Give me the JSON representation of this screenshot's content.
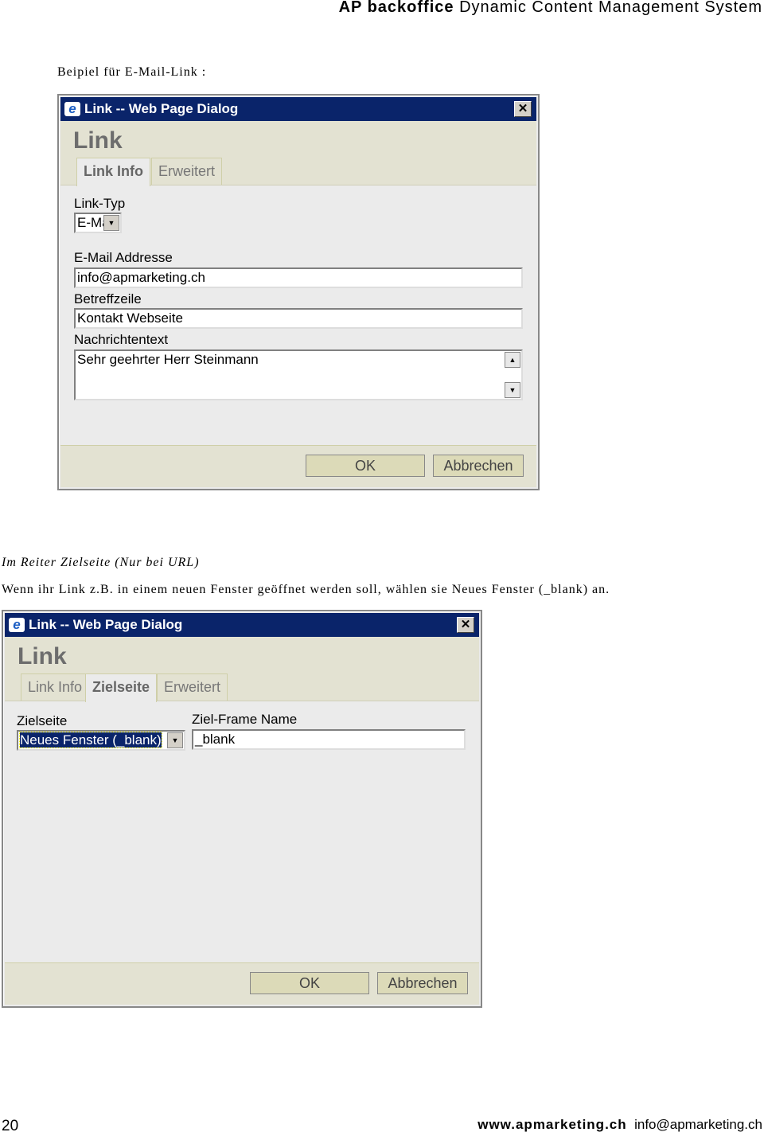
{
  "header": {
    "brand": "AP backoffice",
    "subtitle": "Dynamic Content Management System"
  },
  "intro": "Beipiel für E-Mail-Link :",
  "dialog1": {
    "title": "Link -- Web Page Dialog",
    "heading": "Link",
    "tabs": [
      "Link Info",
      "Erweitert"
    ],
    "active_tab": "Link Info",
    "link_type_label": "Link-Typ",
    "link_type_value": "E-Mail",
    "email_label": "E-Mail Addresse",
    "email_value": "info@apmarketing.ch",
    "subject_label": "Betreffzeile",
    "subject_value": "Kontakt Webseite",
    "body_label": "Nachrichtentext",
    "body_value": "Sehr geehrter Herr Steinmann",
    "ok": "OK",
    "cancel": "Abbrechen"
  },
  "section_title": "Im Reiter Zielseite (Nur bei URL)",
  "section_text": "Wenn ihr Link z.B. in einem neuen Fenster geöffnet werden soll, wählen sie Neues Fenster (_blank) an.",
  "dialog2": {
    "title": "Link -- Web Page Dialog",
    "heading": "Link",
    "tabs": [
      "Link Info",
      "Zielseite",
      "Erweitert"
    ],
    "active_tab": "Zielseite",
    "target_label": "Zielseite",
    "target_value": "Neues Fenster (_blank)",
    "frame_label": "Ziel-Frame Name",
    "frame_value": "_blank",
    "ok": "OK",
    "cancel": "Abbrechen"
  },
  "footer": {
    "page": "20",
    "website": "www.apmarketing.ch",
    "email": "info@apmarketing.ch"
  }
}
